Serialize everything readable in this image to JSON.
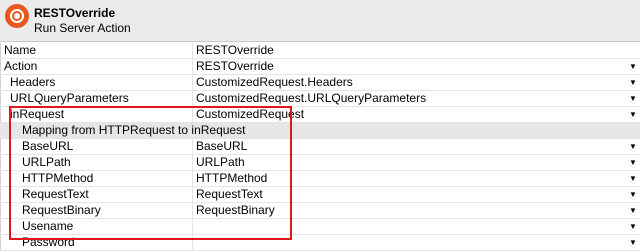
{
  "header": {
    "title": "RESTOverride",
    "subtitle": "Run Server Action"
  },
  "rows": [
    {
      "key": "Name",
      "value": "RESTOverride",
      "dropdown": false
    },
    {
      "key": "Action",
      "value": "RESTOverride",
      "dropdown": true
    },
    {
      "key": "Headers",
      "value": "CustomizedRequest.Headers",
      "dropdown": true
    },
    {
      "key": "URLQueryParameters",
      "value": "CustomizedRequest.URLQueryParameters",
      "dropdown": true
    },
    {
      "key": "inRequest",
      "value": "CustomizedRequest",
      "dropdown": true
    },
    {
      "key": "Mapping from HTTPRequest to inRequest",
      "value": "",
      "dropdown": false
    },
    {
      "key": "BaseURL",
      "value": "BaseURL",
      "dropdown": true
    },
    {
      "key": "URLPath",
      "value": "URLPath",
      "dropdown": true
    },
    {
      "key": "HTTPMethod",
      "value": "HTTPMethod",
      "dropdown": true
    },
    {
      "key": "RequestText",
      "value": "RequestText",
      "dropdown": true
    },
    {
      "key": "RequestBinary",
      "value": "RequestBinary",
      "dropdown": true
    },
    {
      "key": "Usename",
      "value": "",
      "dropdown": true
    },
    {
      "key": "Password",
      "value": "",
      "dropdown": true
    }
  ],
  "icons": {
    "dropdown": "▼",
    "header_icon": "server-action-icon"
  },
  "colors": {
    "highlight_border": "#e2171b",
    "header_icon": "#e8581c"
  }
}
